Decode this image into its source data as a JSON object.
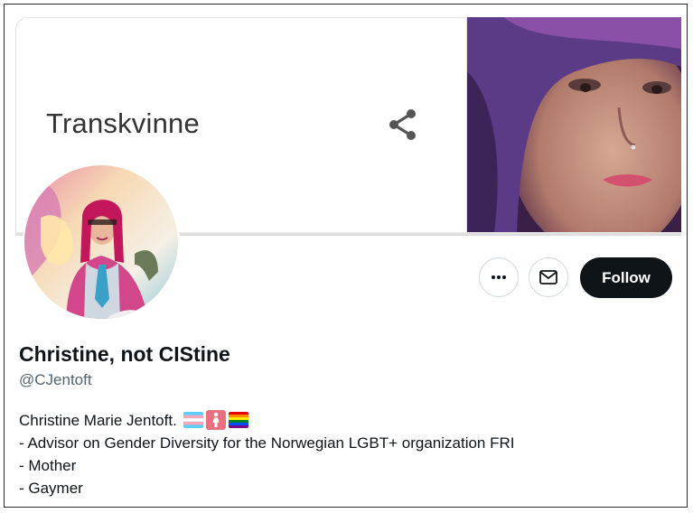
{
  "banner": {
    "word": "Transkvinne"
  },
  "profile": {
    "display_name": "Christine, not CIStine",
    "handle": "@CJentoft",
    "bio_lines": [
      "Christine Marie Jentoft.",
      "- Advisor on Gender Diversity for the Norwegian LGBT+ organization FRI",
      "- Mother",
      "- Gaymer"
    ],
    "bio_emojis": [
      "transgender-flag",
      "womens-symbol",
      "rainbow-flag"
    ]
  },
  "actions": {
    "more_icon": "more-horizontal-icon",
    "message_icon": "envelope-icon",
    "follow_label": "Follow"
  },
  "colors": {
    "follow_bg": "#0f1419",
    "handle": "#536471",
    "border": "#cfd9de"
  }
}
